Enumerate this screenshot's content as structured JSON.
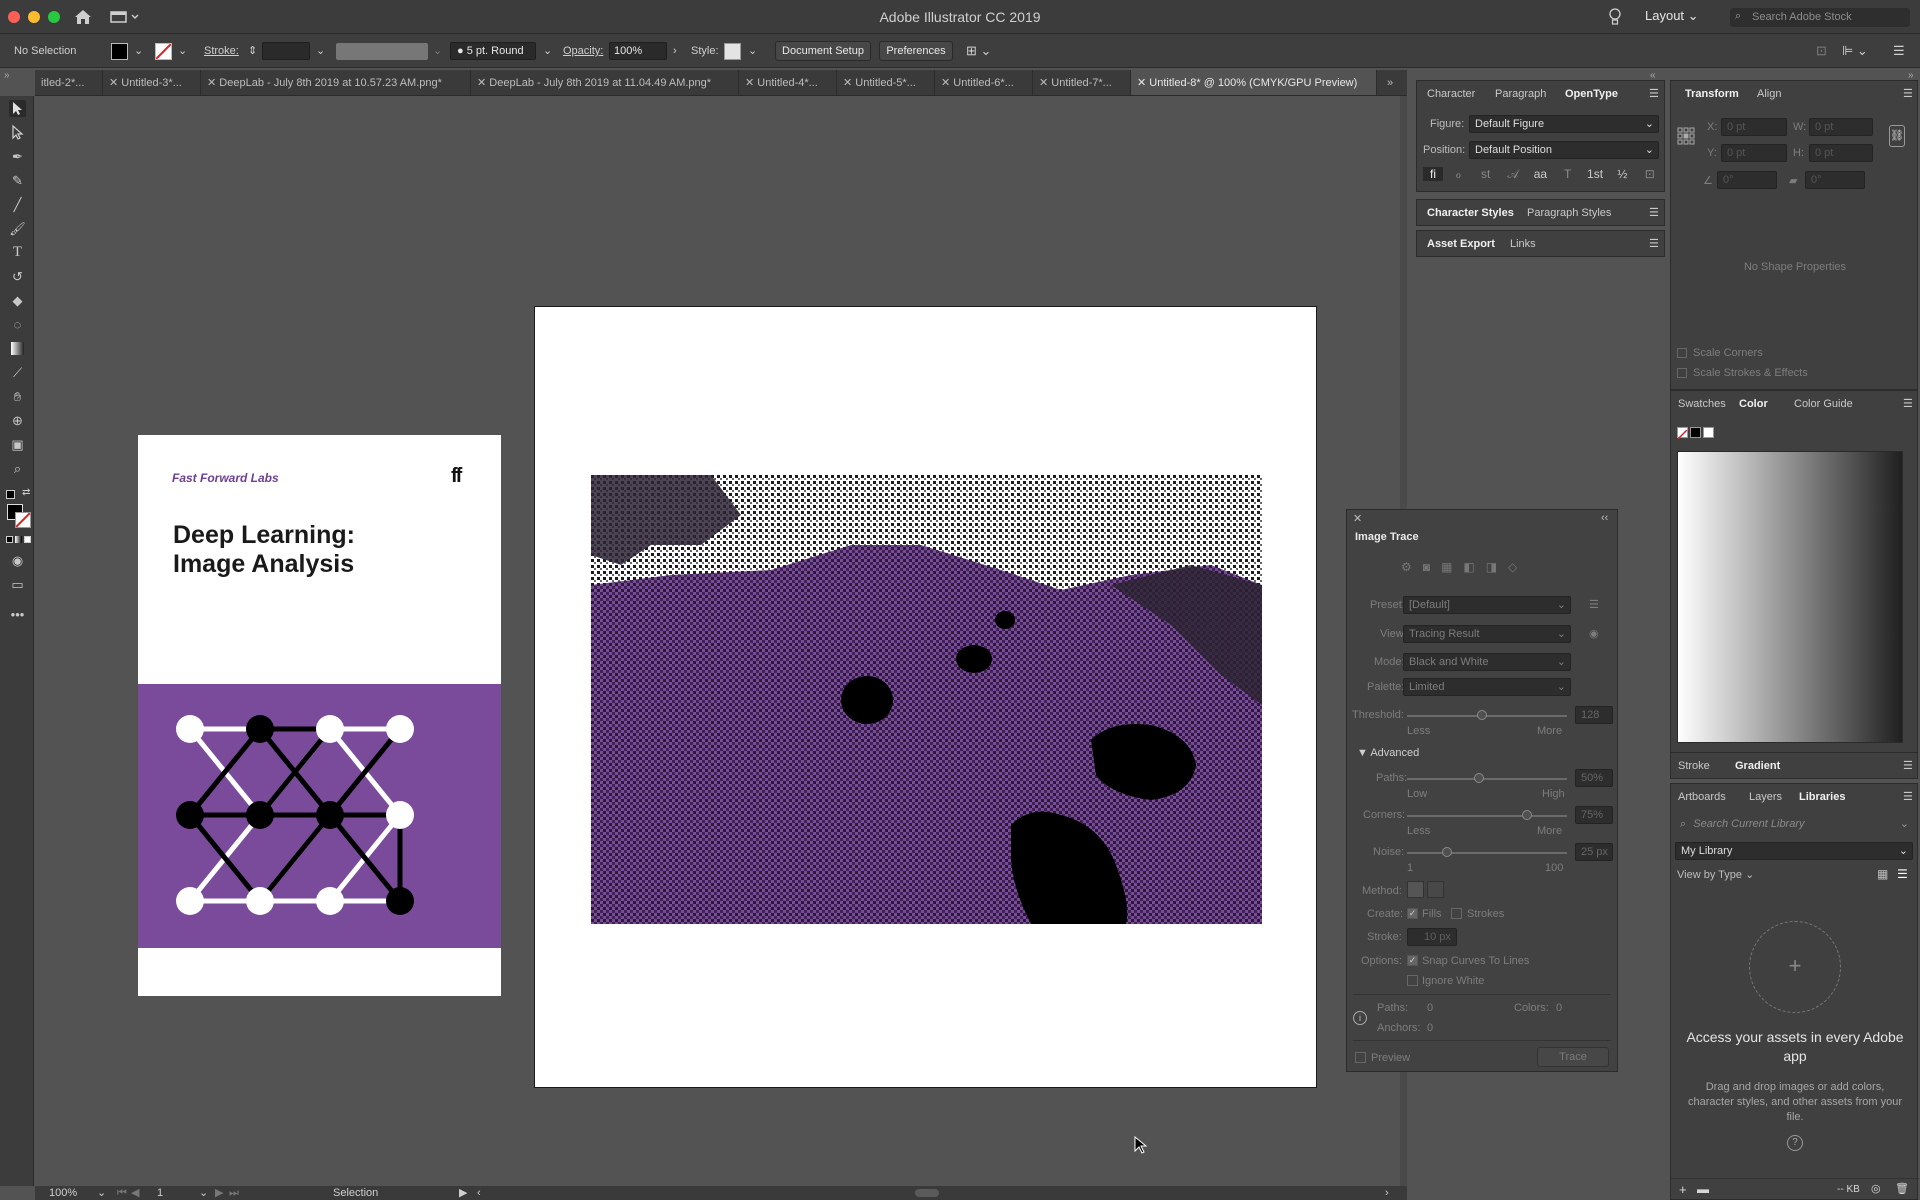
{
  "titlebar": {
    "app_title": "Adobe Illustrator CC 2019",
    "workspace": "Layout",
    "search_placeholder": "Search Adobe Stock"
  },
  "controlbar": {
    "selection": "No Selection",
    "stroke_label": "Stroke:",
    "brush": "5 pt. Round",
    "opacity_label": "Opacity:",
    "opacity_value": "100%",
    "style_label": "Style:",
    "document_setup": "Document Setup",
    "preferences": "Preferences"
  },
  "tabs": [
    {
      "label": "itled-2*..."
    },
    {
      "label": "Untitled-3*..."
    },
    {
      "label": "DeepLab - July 8th 2019 at 10.57.23 AM.png*"
    },
    {
      "label": "DeepLab - July 8th 2019 at 11.04.49 AM.png*"
    },
    {
      "label": "Untitled-4*..."
    },
    {
      "label": "Untitled-5*..."
    },
    {
      "label": "Untitled-6*..."
    },
    {
      "label": "Untitled-7*..."
    },
    {
      "label": "Untitled-8* @ 100% (CMYK/GPU Preview)"
    }
  ],
  "cover": {
    "brand": "Fast Forward Labs",
    "logo": "ff",
    "title_line1": "Deep Learning:",
    "title_line2": "Image Analysis",
    "purple": "#7a4a9b"
  },
  "character_panel": {
    "tabs": [
      "Character",
      "Paragraph",
      "OpenType"
    ],
    "figure_label": "Figure:",
    "figure_value": "Default Figure",
    "position_label": "Position:",
    "position_value": "Default Position",
    "styles_tabs": [
      "Character Styles",
      "Paragraph Styles"
    ],
    "export_tabs": [
      "Asset Export",
      "Links"
    ]
  },
  "transform_panel": {
    "tabs": [
      "Transform",
      "Align"
    ],
    "x_label": "X:",
    "y_label": "Y:",
    "w_label": "W:",
    "h_label": "H:",
    "x_value": "0 pt",
    "y_value": "0 pt",
    "w_value": "0 pt",
    "h_value": "0 pt",
    "angle_value": "0°",
    "shear_value": "0°",
    "no_shape": "No Shape Properties",
    "scale_corners": "Scale Corners",
    "scale_strokes": "Scale Strokes & Effects"
  },
  "color_panel": {
    "tabs": [
      "Swatches",
      "Color",
      "Color Guide"
    ]
  },
  "stroke_panel": {
    "tabs": [
      "Stroke",
      "Gradient"
    ]
  },
  "libraries_panel": {
    "tabs": [
      "Artboards",
      "Layers",
      "Libraries"
    ],
    "search_placeholder": "Search Current Library",
    "library": "My Library",
    "view_by": "View by Type",
    "headline": "Access your assets in every Adobe app",
    "body": "Drag and drop images or add colors, character styles, and other assets from your file.",
    "footer_size": "-- KB"
  },
  "image_trace": {
    "title": "Image Trace",
    "preset_label": "Preset:",
    "preset_value": "[Default]",
    "view_label": "View:",
    "view_value": "Tracing Result",
    "mode_label": "Mode:",
    "mode_value": "Black and White",
    "palette_label": "Palette:",
    "palette_value": "Limited",
    "threshold_label": "Threshold:",
    "threshold_value": "128",
    "less": "Less",
    "more": "More",
    "advanced": "Advanced",
    "paths_label": "Paths:",
    "paths_value": "50%",
    "low": "Low",
    "high": "High",
    "corners_label": "Corners:",
    "corners_value": "75%",
    "noise_label": "Noise:",
    "noise_value": "25 px",
    "noise_min": "1",
    "noise_max": "100",
    "method_label": "Method:",
    "create_label": "Create:",
    "fills": "Fills",
    "strokes": "Strokes",
    "stroke_label": "Stroke:",
    "stroke_value": "10 px",
    "options_label": "Options:",
    "snap": "Snap Curves To Lines",
    "ignore_white": "Ignore White",
    "stat_paths_label": "Paths:",
    "stat_paths": "0",
    "stat_colors_label": "Colors:",
    "stat_colors": "0",
    "stat_anchors_label": "Anchors:",
    "stat_anchors": "0",
    "preview": "Preview",
    "trace_button": "Trace",
    "threshold_level": 0.47,
    "paths_level": 0.45,
    "corners_level": 0.75,
    "noise_level": 0.25
  },
  "statusbar": {
    "zoom": "100%",
    "artboard": "1",
    "tool": "Selection"
  }
}
